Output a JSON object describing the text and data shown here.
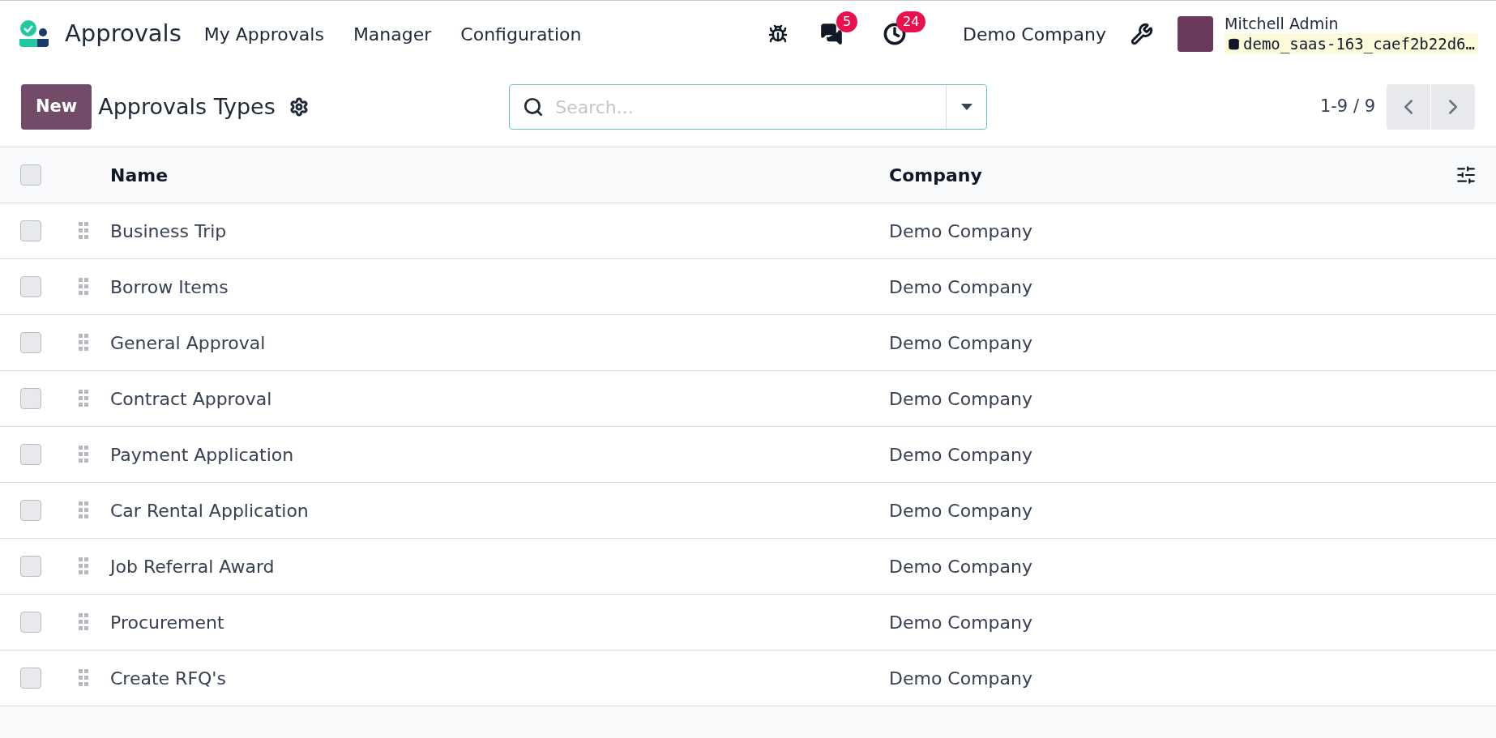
{
  "navbar": {
    "app_name": "Approvals",
    "menu": [
      "My Approvals",
      "Manager",
      "Configuration"
    ],
    "messages_badge": "5",
    "activities_badge": "24",
    "company": "Demo Company",
    "user_name": "Mitchell Admin",
    "database": "demo_saas-163_caef2b22d6…"
  },
  "control_panel": {
    "new_button": "New",
    "title": "Approvals Types",
    "search": {
      "placeholder": "Search..."
    },
    "pager": "1-9 / 9"
  },
  "table": {
    "select_all_checked": false,
    "columns": [
      "Name",
      "Company"
    ],
    "rows": [
      {
        "name": "Business Trip",
        "company": "Demo Company",
        "checked": false
      },
      {
        "name": "Borrow Items",
        "company": "Demo Company",
        "checked": false
      },
      {
        "name": "General Approval",
        "company": "Demo Company",
        "checked": false
      },
      {
        "name": "Contract Approval",
        "company": "Demo Company",
        "checked": false
      },
      {
        "name": "Payment Application",
        "company": "Demo Company",
        "checked": false
      },
      {
        "name": "Car Rental Application",
        "company": "Demo Company",
        "checked": false
      },
      {
        "name": "Job Referral Award",
        "company": "Demo Company",
        "checked": false
      },
      {
        "name": "Procurement",
        "company": "Demo Company",
        "checked": false
      },
      {
        "name": "Create RFQ's",
        "company": "Demo Company",
        "checked": false
      }
    ]
  }
}
